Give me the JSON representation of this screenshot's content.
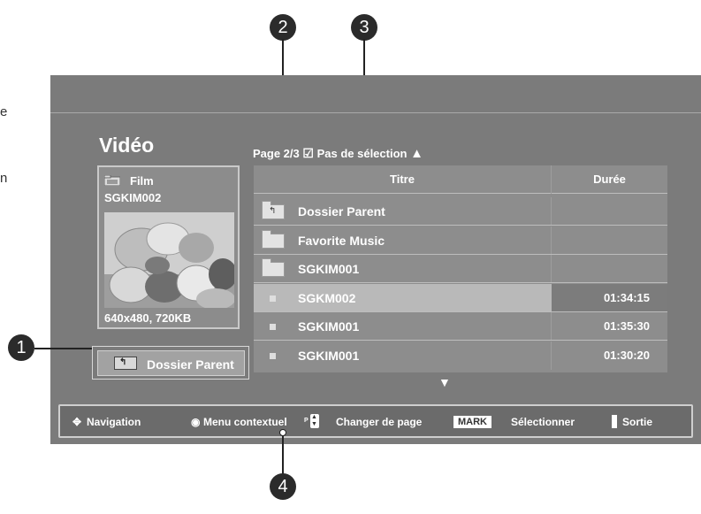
{
  "side_text": {
    "line1": "e",
    "line2": "n"
  },
  "callouts": {
    "c1": "1",
    "c2": "2",
    "c3": "3",
    "c4": "4"
  },
  "header": {
    "title": "Vidéo"
  },
  "preview": {
    "type_label": "Film",
    "name": "SGKIM002",
    "info": "640x480, 720KB",
    "icon": "folder-icon"
  },
  "parent_button": {
    "label": "Dossier Parent",
    "icon": "folder-up-icon"
  },
  "page_info": {
    "page": "Page 2/3",
    "checkbox_symbol": "☑",
    "selection": "Pas de sélection",
    "up_arrow": "▲",
    "down_arrow": "▼"
  },
  "list": {
    "columns": {
      "title": "Titre",
      "duration": "Durée"
    },
    "rows": [
      {
        "name": "Dossier Parent",
        "duration": "",
        "icon": "folder-up-icon"
      },
      {
        "name": "Favorite Music",
        "duration": "",
        "icon": "folder-icon"
      },
      {
        "name": "SGKIM001",
        "duration": "",
        "icon": "folder-icon"
      },
      {
        "name": "SGKM002",
        "duration": "01:34:15",
        "icon": "file-bullet-icon",
        "selected": true
      },
      {
        "name": "SGKIM001",
        "duration": "01:35:30",
        "icon": "file-bullet-icon"
      },
      {
        "name": "SGKIM001",
        "duration": "01:30:20",
        "icon": "file-bullet-icon"
      }
    ]
  },
  "footer": {
    "nav_icon": "✥",
    "navigation": "Navigation",
    "menu_icon": "◉",
    "menu": "Menu contextuel",
    "p_label": "P",
    "page_change": "Changer de page",
    "mark_key": "MARK",
    "select": "Sélectionner",
    "exit": "Sortie"
  },
  "colors": {
    "tv_bg": "#7b7b7b",
    "list_bg": "#8d8d8d",
    "selected_row": "#b9b9b9",
    "footer_bg": "#6b6b6b"
  }
}
